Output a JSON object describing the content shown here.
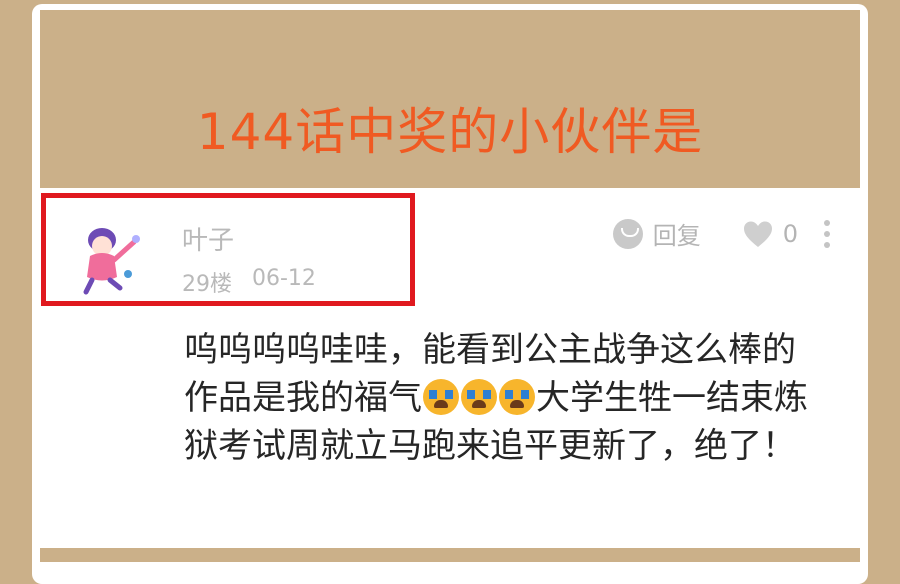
{
  "banner": {
    "title": "144话中奖的小伙伴是"
  },
  "comment": {
    "username": "叶子",
    "floor": "29楼",
    "date": "06-12",
    "reply_label": "回复",
    "like_count": "0",
    "text_before_emoji": "呜呜呜呜哇哇，能看到公主战争这么棒的作品是我的福气",
    "emojis": [
      "crying-emoji",
      "crying-emoji",
      "crying-emoji"
    ],
    "text_after_emoji": "大学生牲一结束炼狱考试周就立马跑来追平更新了，绝了！"
  },
  "colors": {
    "background": "#cbb089",
    "title_color": "#f05a22",
    "highlight_border": "#e0191f",
    "muted_text": "#b9b9b9"
  }
}
